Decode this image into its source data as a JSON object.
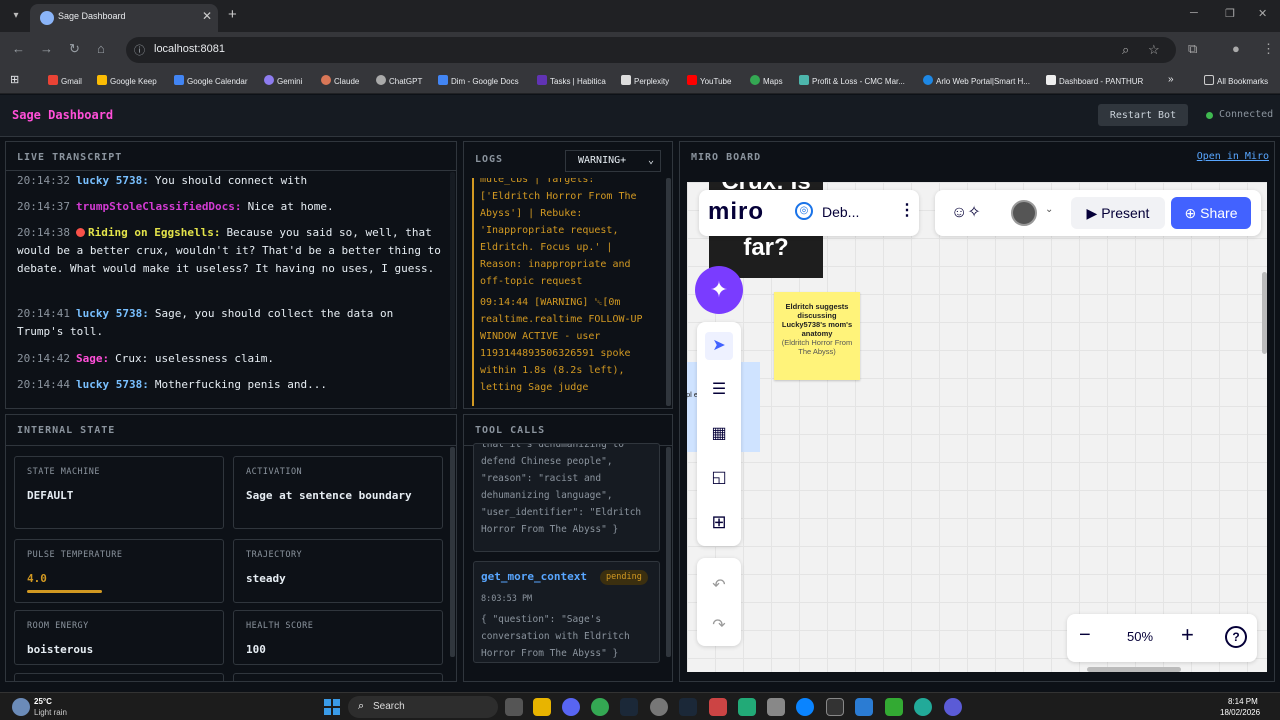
{
  "browser": {
    "tab_title": "Sage Dashboard",
    "url": "localhost:8081",
    "bookmarks": [
      "Gmail",
      "Google Keep",
      "Google Calendar",
      "Gemini",
      "Claude",
      "ChatGPT",
      "Dim - Google Docs",
      "Tasks | Habitica",
      "Perplexity",
      "YouTube",
      "Maps",
      "Profit & Loss - CMC Mar...",
      "Arlo Web Portal|Smart H...",
      "Dashboard - PANTHUR"
    ],
    "all_bookmarks": "All Bookmarks"
  },
  "header": {
    "title": "Sage Dashboard",
    "restart_label": "Restart Bot",
    "status": "Connected"
  },
  "transcript": {
    "title": "LIVE TRANSCRIPT",
    "messages": [
      {
        "time": "20:14:32",
        "speaker": "lucky 5738:",
        "text": "You should connect with",
        "color": "#79c0ff"
      },
      {
        "time": "20:14:37",
        "speaker": "trumpStoleClassifiedDocs:",
        "text": "Nice at home.",
        "color": "#d33bd3"
      },
      {
        "time": "20:14:38",
        "speaker": "Riding on Eggshells:",
        "text": "Because you said so, well, that would be a better crux, wouldn't it? That'd be a better thing to debate. What would make it useless? It having no uses, I guess.",
        "color": "#e3e34a"
      },
      {
        "time": "20:14:41",
        "speaker": "lucky 5738:",
        "text": "Sage, you should collect the data on Trump's toll.",
        "color": "#79c0ff"
      },
      {
        "time": "20:14:42",
        "speaker": "Sage:",
        "text": "Crux: uselessness claim.",
        "color": "#ff4fd8"
      },
      {
        "time": "20:14:44",
        "speaker": "lucky 5738:",
        "text": "Motherfucking penis and...",
        "color": "#79c0ff"
      }
    ]
  },
  "logs": {
    "title": "LOGS",
    "level": "WARNING+",
    "entries": [
      "mute_cbs | Targets: ['Eldritch Horror From The Abyss'] | Rebuke: 'Inappropriate request, Eldritch. Focus up.' | Reason: inappropriate and off-topic request",
      "09:14:44  [WARNING]  ␛[0m realtime.realtime FOLLOW-UP WINDOW ACTIVE - user 1193144893506326591 spoke within 1.8s (8.2s left), letting Sage judge"
    ]
  },
  "internal": {
    "title": "INTERNAL STATE",
    "cards": [
      {
        "label": "STATE MACHINE",
        "value": "DEFAULT"
      },
      {
        "label": "ACTIVATION",
        "value": "Sage at sentence boundary"
      },
      {
        "label": "PULSE TEMPERATURE",
        "value": "4.0",
        "level": 0.4
      },
      {
        "label": "TRAJECTORY",
        "value": "steady"
      },
      {
        "label": "ROOM ENERGY",
        "value": "boisterous"
      },
      {
        "label": "HEALTH SCORE",
        "value": "100"
      }
    ]
  },
  "toolcalls": {
    "title": "TOOL CALLS",
    "partial_args": "that it's dehumanizing to defend Chinese people\", \"reason\": \"racist and dehumanizing language\", \"user_identifier\": \"Eldritch Horror From The Abyss\" }",
    "call": {
      "name": "get_more_context",
      "status": "pending",
      "time": "8:03:53 PM",
      "args": "{ \"question\": \"Sage's conversation with Eldritch Horror From The Abyss\" }"
    }
  },
  "miro": {
    "title": "MIRO BOARD",
    "open_link": "Open in Miro",
    "logo": "miro",
    "board_name": "Deb...",
    "present_label": "Present",
    "share_label": "Share",
    "zoom": "50%",
    "crux_lines": [
      "Crux: Is",
      "far?"
    ],
    "sticky_bold": "Eldritch suggests discussing Lucky5738's mom's anatomy",
    "sticky_sub": "(Eldritch Horror From The Abyss)",
    "blue_note": "pl  e so  a"
  },
  "taskbar": {
    "temp": "25°C",
    "weather": "Light rain",
    "search": "Search",
    "time": "8:14 PM",
    "date": "18/02/2026"
  }
}
